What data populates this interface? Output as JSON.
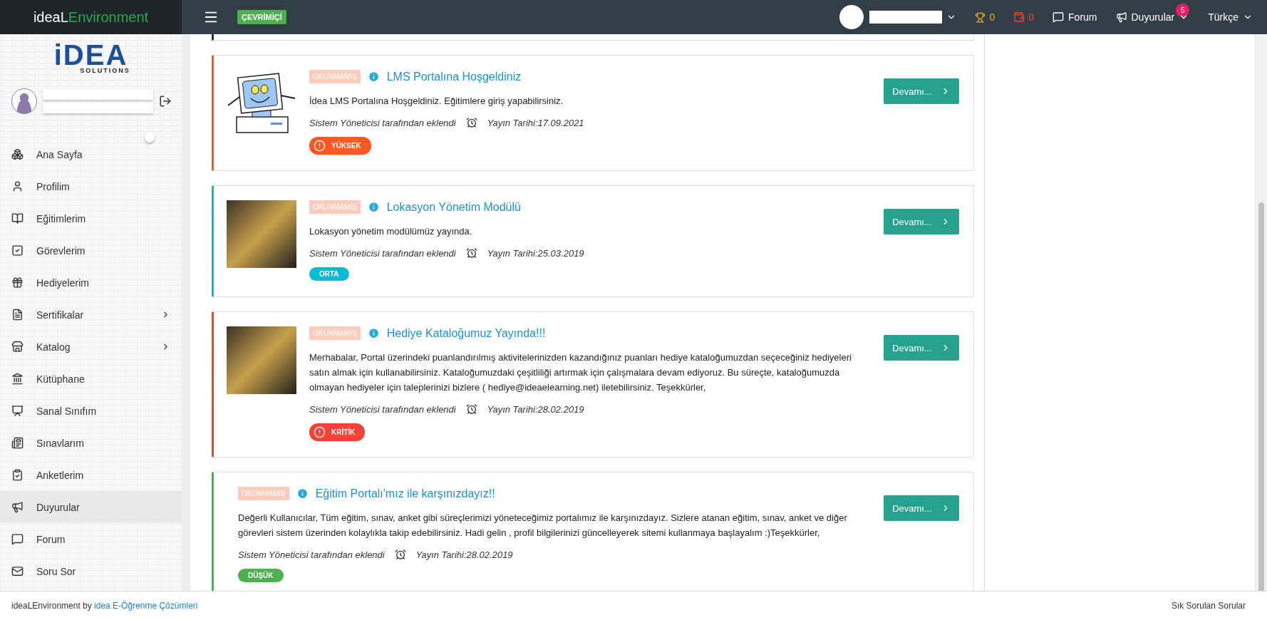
{
  "topbar": {
    "brand": {
      "first": "ideaL",
      "second": "Environment"
    },
    "status_badge": "ÇEVRİMİÇİ",
    "trophy_count": "0",
    "wallet_count": "0",
    "forum": "Forum",
    "announcements": {
      "label": "Duyurular",
      "badge": "5"
    },
    "language": "Türkçe"
  },
  "sidebar": {
    "logo": {
      "main": "iDEA",
      "sub": "SOLUTIONS"
    },
    "items": [
      {
        "label": "Ana Sayfa",
        "selected": false,
        "submenu": false
      },
      {
        "label": "Profilim",
        "selected": false,
        "submenu": false
      },
      {
        "label": "Eğitimlerim",
        "selected": false,
        "submenu": false
      },
      {
        "label": "Görevlerim",
        "selected": false,
        "submenu": false
      },
      {
        "label": "Hediyelerim",
        "selected": false,
        "submenu": false
      },
      {
        "label": "Sertifikalar",
        "selected": false,
        "submenu": true
      },
      {
        "label": "Katalog",
        "selected": false,
        "submenu": true
      },
      {
        "label": "Kütüphane",
        "selected": false,
        "submenu": false
      },
      {
        "label": "Sanal Sınıfım",
        "selected": false,
        "submenu": false
      },
      {
        "label": "Sınavlarım",
        "selected": false,
        "submenu": false
      },
      {
        "label": "Anketlerim",
        "selected": false,
        "submenu": false
      },
      {
        "label": "Duyurular",
        "selected": true,
        "submenu": false
      },
      {
        "label": "Forum",
        "selected": false,
        "submenu": false
      },
      {
        "label": "Soru Sor",
        "selected": false,
        "submenu": false
      }
    ]
  },
  "announcements": [
    {
      "status": "OKUNMAMIŞ",
      "title": "LMS Portalına Hoşgeldiniz",
      "text": "İdea LMS Portalına Hoşgeldiniz. Eğitimlere giriş yapabilirsiniz.",
      "author": "Sistem Yöneticisi tarafından eklendi",
      "date": "Yayın Tarihi:17.09.2021",
      "priority": "YÜKSEK",
      "alert": true,
      "color": "#ff5722",
      "kind": "drawing",
      "button": "Devamı..."
    },
    {
      "status": "OKUNMAMIŞ",
      "title": "Lokasyon Yönetim Modülü",
      "text": "Lokasyon yönetim modülümüz yayında.",
      "author": "Sistem Yöneticisi tarafından eklendi",
      "date": "Yayın Tarihi:25.03.2019",
      "priority": "ORTA",
      "alert": false,
      "color": "#00bcd4",
      "kind": "photo",
      "button": "Devamı..."
    },
    {
      "status": "OKUNMAMIŞ",
      "title": "Hediye Kataloğumuz Yayında!!!",
      "text": "Merhabalar, Portal üzerindeki puanlandırılmış aktivitelerinizden kazandığınız puanları hediye kataloğumuzdan seçeceğiniz hediyeleri satın almak için kullanabilirsiniz. Kataloğumuzdaki çeşitliliği artırmak için çalışmalara devam ediyoruz. Bu süreçte, kataloğumuzda olmayan hediyeler için taleplerinizi bizlere ( hediye@ideaelearning.net) iletebilirsiniz. Teşekkürler,",
      "author": "Sistem Yöneticisi tarafından eklendi",
      "date": "Yayın Tarihi:28.02.2019",
      "priority": "KRİTİK",
      "alert": true,
      "color": "#f44336",
      "kind": "photo",
      "button": "Devamı..."
    },
    {
      "status": "OKUNMAMIŞ",
      "title": "Eğitim Portalı'mız ile karşınızdayız!!",
      "text": "Değerli Kullanıcılar, Tüm eğitim, sınav, anket gibi süreçlerimizi yöneteceğimiz portalımız ile karşınızdayız. Sizlere atanan eğitim, sınav, anket ve diğer görevleri sistem üzerinden kolaylıkla takip edebilirsiniz. Hadi gelin , profil bilgilerinizi güncelleyerek sitemi kullanmaya başlayalım :)Teşekkürler,",
      "author": "Sistem Yöneticisi tarafından eklendi",
      "date": "Yayın Tarihi:28.02.2019",
      "priority": "DÜŞÜK",
      "alert": false,
      "color": "#4caf50",
      "kind": "text",
      "button": "Devamı..."
    }
  ],
  "footer": {
    "text": "ideaLEnvironment by",
    "link": "idea E-Öğrenme Çözümleri",
    "right": "Sık Sorulan Sorular"
  }
}
